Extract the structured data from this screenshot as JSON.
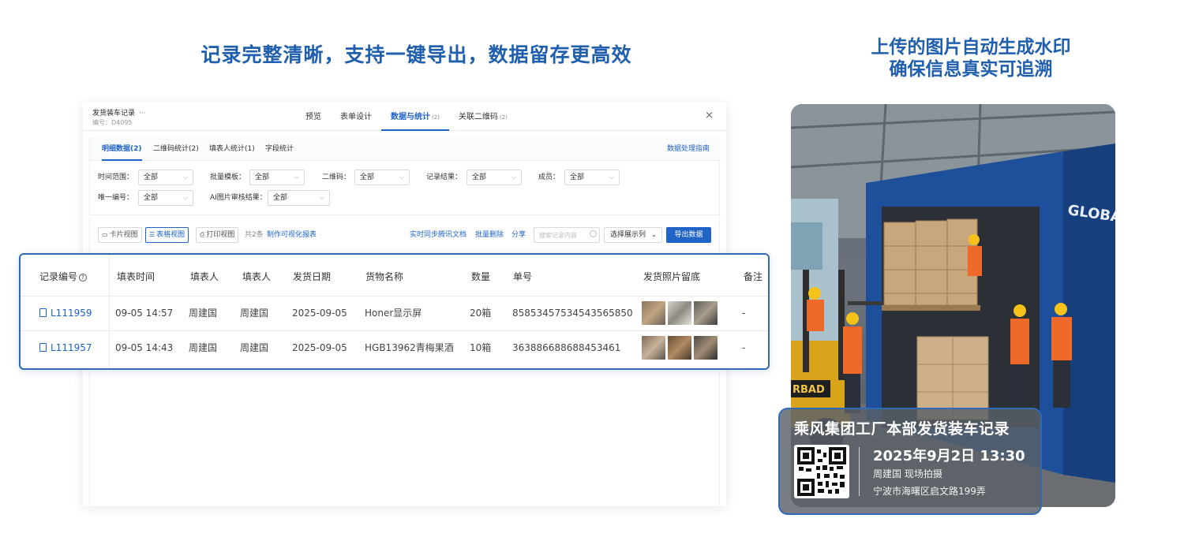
{
  "headline_left": "记录完整清晰，支持一键导出，数据留存更高效",
  "headline_right": [
    "上传的图片自动生成水印",
    "确保信息真实可追溯"
  ],
  "app": {
    "form_name": "发货装车记录",
    "more": "···",
    "form_code": "编号：D4095",
    "tabs": [
      {
        "label": "预览",
        "count": ""
      },
      {
        "label": "表单设计",
        "count": ""
      },
      {
        "label": "数据与统计",
        "count": "(2)"
      },
      {
        "label": "关联二维码",
        "count": "(2)"
      }
    ],
    "close": "×"
  },
  "sub_tabs": [
    "明细数据(2)",
    "二维码统计(2)",
    "填表人统计(1)",
    "字段统计"
  ],
  "guide_link": "数据处理指南",
  "filters": [
    {
      "label": "时间范围：",
      "value": "全部"
    },
    {
      "label": "批量模板：",
      "value": "全部"
    },
    {
      "label": "二维码：",
      "value": "全部"
    },
    {
      "label": "记录结果：",
      "value": "全部"
    },
    {
      "label": "成员：",
      "value": "全部"
    },
    {
      "label": "唯一编号：",
      "value": "全部"
    },
    {
      "label": "AI图片审核结果：",
      "value": "全部"
    }
  ],
  "toolbar": {
    "card_view": "卡片视图",
    "table_view": "表格视图",
    "print_view": "打印视图",
    "count": "共2条",
    "make_report": "制作可视化报表",
    "sync_doc": "实时同步腾讯文档",
    "batch_delete": "批量删除",
    "share": "分享",
    "search_placeholder": "搜索记录内容",
    "choose_columns": "选择展示列",
    "export": "导出数据"
  },
  "table": {
    "headers": [
      "记录编号",
      "填表时间",
      "填表人",
      "填表人",
      "发货日期",
      "货物名称",
      "数量",
      "单号",
      "发货照片留底",
      "备注"
    ],
    "help_mark": "?",
    "rows": [
      [
        "L111959",
        "09-05 14:57",
        "周建国",
        "周建国",
        "2025-09-05",
        "Honer显示屏",
        "20箱",
        "85853457534543565850",
        "-"
      ],
      [
        "L111957",
        "09-05 14:43",
        "周建国",
        "周建国",
        "2025-09-05",
        "HGB13962青梅果酒",
        "10箱",
        "363886688688453461",
        "-"
      ]
    ]
  },
  "photo": {
    "truck_text": "GLOBAL FREI",
    "forklift_text": "RBAD"
  },
  "watermark": {
    "title": "乘风集团工厂本部发货装车记录",
    "datetime": "2025年9月2日  13:30",
    "person": "周建国  现场拍摄",
    "address": "宁波市海曙区启文路199弄"
  },
  "colors": {
    "accent": "#1f64c6",
    "headline": "#1f5fae",
    "frame": "#2f6ab8"
  }
}
